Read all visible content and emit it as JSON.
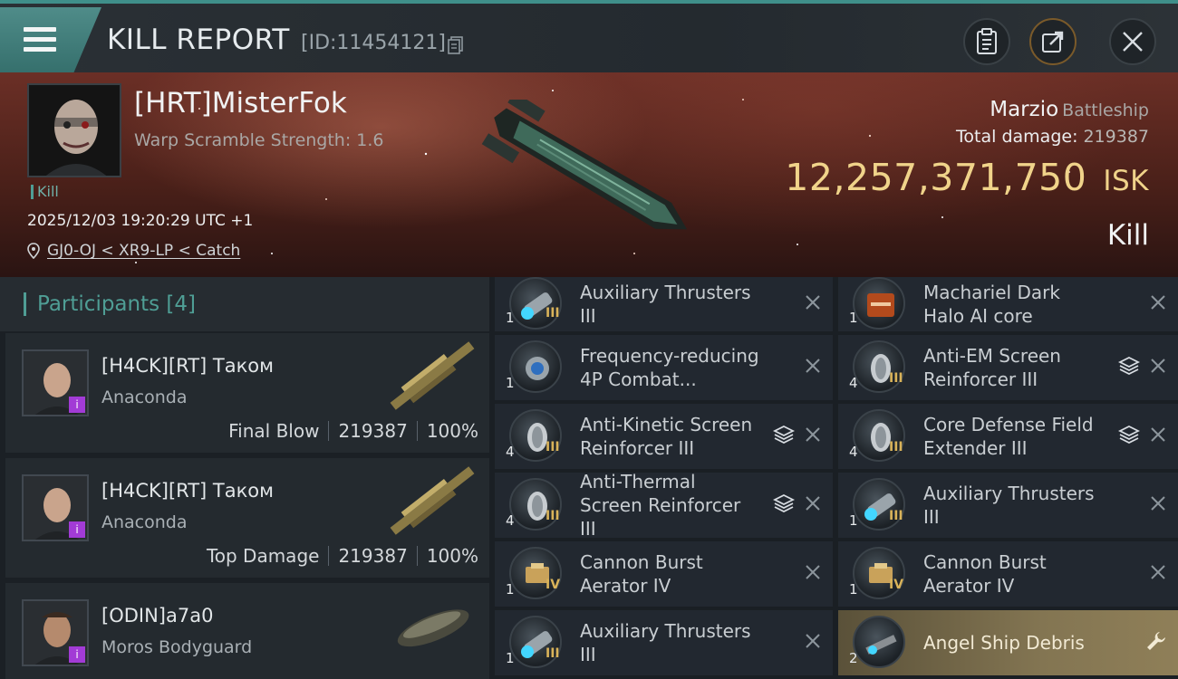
{
  "header": {
    "title": "KILL REPORT",
    "report_id": "[ID:11454121]"
  },
  "victim": {
    "name": "[HRT]MisterFok",
    "warp_scramble": "Warp Scramble Strength: 1.6",
    "tag": "Kill",
    "datetime": "2025/12/03 19:20:29 UTC +1",
    "location": "GJ0-OJ < XR9-LP < Catch",
    "ship_name": "Marzio",
    "ship_class": "Battleship",
    "total_damage_label": "Total damage:",
    "total_damage": "219387",
    "isk_value": "12,257,371,750",
    "isk_unit": "ISK",
    "result": "Kill"
  },
  "participants": {
    "label": "Participants",
    "count": "[4]",
    "list": [
      {
        "name": "[H4CK][RT] Таком",
        "ship": "Anaconda",
        "role": "Final Blow",
        "damage": "219387",
        "percent": "100%"
      },
      {
        "name": "[H4CK][RT] Таком",
        "ship": "Anaconda",
        "role": "Top Damage",
        "damage": "219387",
        "percent": "100%"
      },
      {
        "name": "[ODIN]a7a0",
        "ship": "Moros Bodyguard",
        "role": "",
        "damage": "",
        "percent": ""
      }
    ]
  },
  "modules_left": [
    {
      "qty": "1",
      "tier": "III",
      "name": "Auxiliary Thrusters III",
      "icon": "thruster-icon"
    },
    {
      "qty": "1",
      "tier": "",
      "name": "Frequency-reducing 4P Combat...",
      "icon": "combat-module-icon"
    },
    {
      "qty": "4",
      "tier": "III",
      "name": "Anti-Kinetic Screen Reinforcer III",
      "icon": "shield-reinforcer-icon"
    },
    {
      "qty": "4",
      "tier": "III",
      "name": "Anti-Thermal Screen Reinforcer III",
      "icon": "shield-reinforcer-icon"
    },
    {
      "qty": "1",
      "tier": "IV",
      "name": "Cannon Burst Aerator IV",
      "icon": "cannon-aerator-icon"
    },
    {
      "qty": "1",
      "tier": "III",
      "name": "Auxiliary Thrusters III",
      "icon": "thruster-icon"
    }
  ],
  "modules_right": [
    {
      "qty": "1",
      "tier": "",
      "name": "Machariel Dark Halo AI core",
      "icon": "ai-core-icon"
    },
    {
      "qty": "4",
      "tier": "III",
      "name": "Anti-EM Screen Reinforcer III",
      "icon": "shield-reinforcer-icon"
    },
    {
      "qty": "4",
      "tier": "III",
      "name": "Core Defense Field Extender III",
      "icon": "shield-reinforcer-icon"
    },
    {
      "qty": "1",
      "tier": "III",
      "name": "Auxiliary Thrusters III",
      "icon": "thruster-icon"
    },
    {
      "qty": "1",
      "tier": "IV",
      "name": "Cannon Burst Aerator IV",
      "icon": "cannon-aerator-icon"
    },
    {
      "qty": "2",
      "tier": "",
      "name": "Angel Ship Debris",
      "icon": "debris-icon"
    }
  ],
  "colors": {
    "accent": "#4f9e95",
    "isk": "#f0d38a",
    "banner": "#6b2f26",
    "loot_highlight": "#837552"
  }
}
